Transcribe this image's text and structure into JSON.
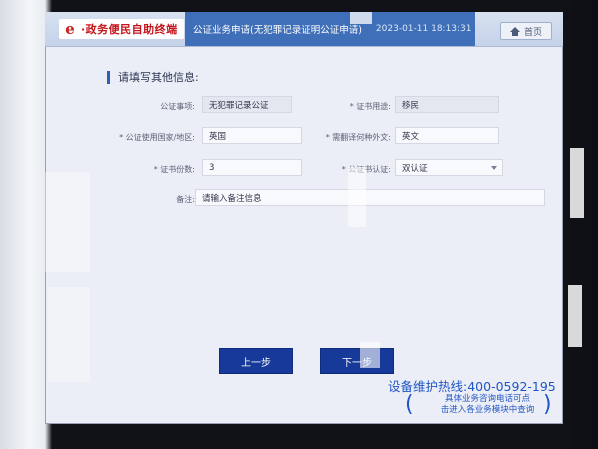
{
  "header": {
    "logo_mark": "e",
    "logo_text": "·政务便民自助终端",
    "page_title": "公证业务申请(无犯罪记录证明公证申请)",
    "timestamp": "2023-01-11 18:13:31",
    "home_label": "首页"
  },
  "form": {
    "section_title": "请填写其他信息:",
    "notary_matter_label": "公证事项:",
    "notary_matter_value": "无犯罪记录公证",
    "cert_purpose_label": "* 证书用途:",
    "cert_purpose_value": "移民",
    "country_label": "* 公证使用国家/地区:",
    "country_value": "英国",
    "translation_label": "* 需翻译何种外文:",
    "translation_value": "英文",
    "copies_label": "* 证书份数:",
    "copies_value": "3",
    "certification_label": "* 公证书认证:",
    "certification_value": "双认证",
    "remarks_label": "备注:",
    "remarks_placeholder": "请输入备注信息"
  },
  "footer": {
    "prev_label": "上一步",
    "next_label": "下一步",
    "hotline": "设备维护热线:400-0592-195",
    "consult_line1": "具体业务咨询电话可点",
    "consult_line2": "击进入各业务模块中查询",
    "paren_left": "(",
    "paren_right": ")"
  },
  "colors": {
    "accent": "#17399a",
    "title_bar": "#3e6fb8",
    "logo_red": "#c3141b",
    "hotline_blue": "#1f55c4"
  }
}
